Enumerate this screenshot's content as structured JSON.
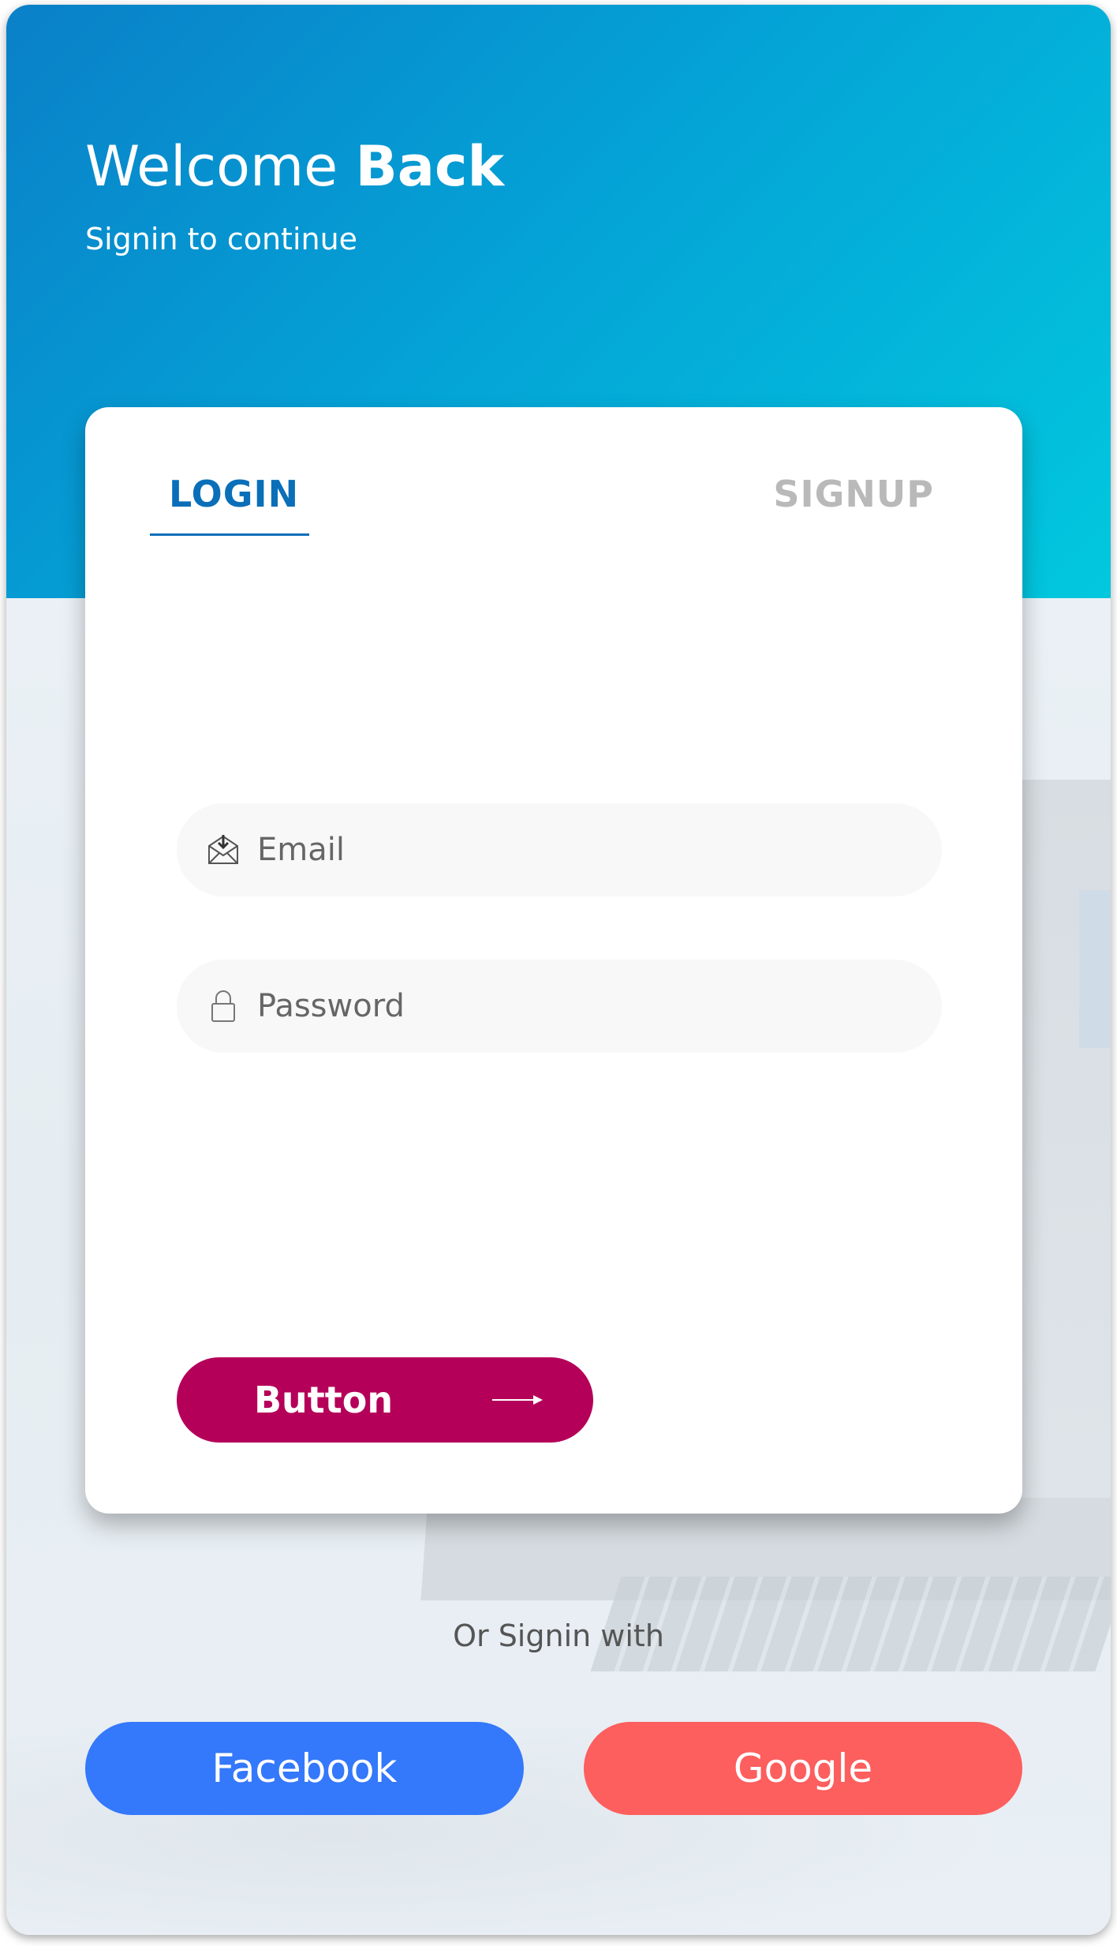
{
  "header": {
    "title_regular": "Welcome ",
    "title_bold": "Back",
    "subtitle": "Signin to continue"
  },
  "tabs": {
    "login": "LOGIN",
    "signup": "SIGNUP",
    "active": "login"
  },
  "form": {
    "email": {
      "placeholder": "Email",
      "value": "",
      "icon": "envelope-download-icon"
    },
    "password": {
      "placeholder": "Password",
      "value": "",
      "icon": "lock-icon"
    },
    "submit_label": "Button",
    "submit_icon": "arrow-right-icon"
  },
  "social": {
    "divider_text": "Or Signin with",
    "facebook_label": "Facebook",
    "google_label": "Google"
  },
  "colors": {
    "header_gradient_start": "#0a80c8",
    "header_gradient_end": "#02c8de",
    "tab_active": "#0a6fb8",
    "tab_inactive": "#b9b9b9",
    "submit_button": "#b5005a",
    "facebook": "#3478fb",
    "google": "#fd5e5e"
  }
}
